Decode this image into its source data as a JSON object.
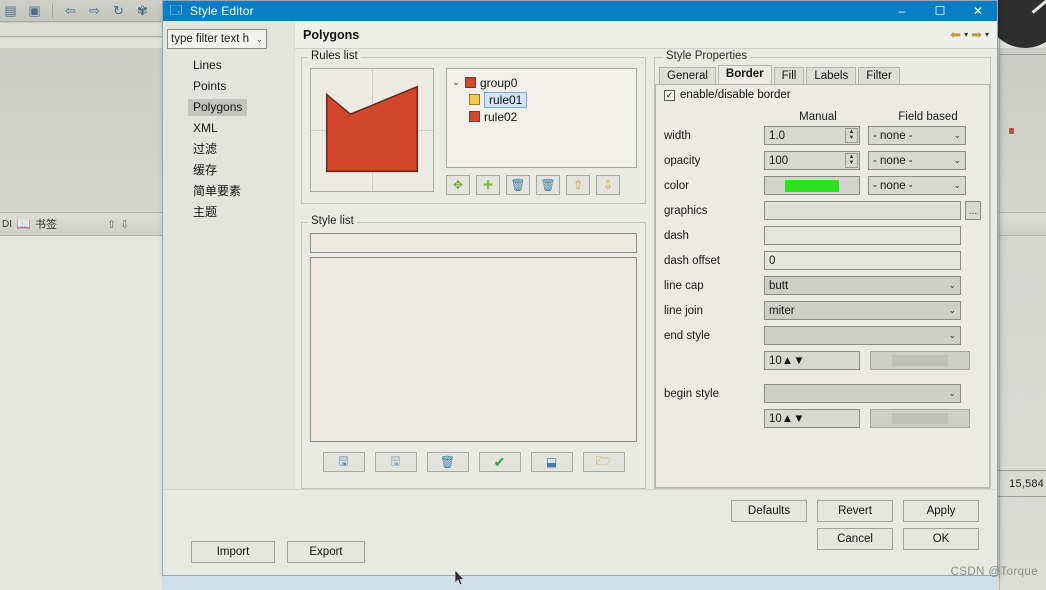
{
  "background": {
    "toolbar_icons": [
      "panel-icon",
      "panel-split-icon",
      "back-arrow-icon",
      "forward-arrow-icon",
      "refresh-icon",
      "globe-icon",
      "fullscreen-icon",
      "zoom-in-icon",
      "zoom-out-icon"
    ],
    "bookmark_label": "书签",
    "bookmark_prefix": "DI",
    "bookmark_up_icon": "up-arrow-icon",
    "bookmark_down_icon": "down-arrow-icon",
    "right_value": "15,584"
  },
  "window": {
    "title": "Style Editor",
    "app_icon": "style-editor-icon",
    "minimize": "–",
    "maximize": "☐",
    "close": "✕"
  },
  "sidebar": {
    "filter": {
      "value": "type filter text h",
      "placeholder": "type filter text here",
      "caret_icon": "chevron-down-icon"
    },
    "items": [
      {
        "label": "Lines",
        "selected": false
      },
      {
        "label": "Points",
        "selected": false
      },
      {
        "label": "Polygons",
        "selected": true
      },
      {
        "label": "XML",
        "selected": false
      },
      {
        "label": "过滤",
        "selected": false
      },
      {
        "label": "缓存",
        "selected": false
      },
      {
        "label": "简单要素",
        "selected": false
      },
      {
        "label": "主题",
        "selected": false
      }
    ]
  },
  "content": {
    "title": "Polygons",
    "header_actions": [
      {
        "name": "back-arrow-icon",
        "glyph": "⬅"
      },
      {
        "name": "chevron-down-icon",
        "glyph": "▾"
      },
      {
        "name": "forward-arrow-icon",
        "glyph": "➡"
      },
      {
        "name": "chevron-down-icon",
        "glyph": "▾"
      }
    ]
  },
  "rules": {
    "group_label": "Rules list",
    "preview_name": "polygon-preview",
    "preview_fill": "#d2472a",
    "preview_stroke": "#6b2a1c",
    "tree": [
      {
        "label": "group0",
        "level": 0,
        "swatch": "red",
        "selected": false,
        "twisty": "⌄"
      },
      {
        "label": "rule01",
        "level": 1,
        "swatch": "yellow",
        "selected": true,
        "twisty": ""
      },
      {
        "label": "rule02",
        "level": 1,
        "swatch": "red",
        "selected": false,
        "twisty": ""
      }
    ],
    "toolbar": [
      {
        "name": "add-group-button",
        "glyph": "✥"
      },
      {
        "name": "add-rule-button",
        "glyph": "✚"
      },
      {
        "name": "delete-rule-button",
        "glyph": "🗑"
      },
      {
        "name": "delete-all-rules-button",
        "glyph": "🗑"
      },
      {
        "name": "move-up-button",
        "glyph": "⇧"
      },
      {
        "name": "move-down-button",
        "glyph": "⇩"
      }
    ]
  },
  "style_list": {
    "group_label": "Style list",
    "field_value": "",
    "toolbar": [
      {
        "name": "save-style-button",
        "glyph": "💾"
      },
      {
        "name": "save-as-style-button",
        "glyph": "🖫"
      },
      {
        "name": "delete-style-button",
        "glyph": "🗑"
      },
      {
        "name": "validate-style-button",
        "glyph": "✔"
      },
      {
        "name": "export-style-button",
        "glyph": "⬓"
      },
      {
        "name": "open-style-button",
        "glyph": "📂"
      }
    ]
  },
  "style_properties": {
    "group_label": "Style Properties",
    "tabs": [
      {
        "label": "General",
        "active": false
      },
      {
        "label": "Border",
        "active": true
      },
      {
        "label": "Fill",
        "active": false
      },
      {
        "label": "Labels",
        "active": false
      },
      {
        "label": "Filter",
        "active": false
      }
    ],
    "enable_border": {
      "label": "enable/disable border",
      "checked": true,
      "check_glyph": "✓"
    },
    "columns": {
      "manual": "Manual",
      "field_based": "Field based"
    },
    "field_none": "- none -",
    "color_swatch": "#2ce022",
    "rows": [
      {
        "label": "width",
        "type": "spinner",
        "value": "1.0",
        "field": "- none -"
      },
      {
        "label": "opacity",
        "type": "spinner",
        "value": "100",
        "field": "- none -"
      },
      {
        "label": "color",
        "type": "color",
        "value": "",
        "field": "- none -"
      },
      {
        "label": "graphics",
        "type": "text-dots",
        "value": "",
        "field": ""
      },
      {
        "label": "dash",
        "type": "text",
        "value": "",
        "field": ""
      },
      {
        "label": "dash offset",
        "type": "text",
        "value": "0",
        "field": ""
      },
      {
        "label": "line cap",
        "type": "combo",
        "value": "butt",
        "field": ""
      },
      {
        "label": "line join",
        "type": "combo",
        "value": "miter",
        "field": ""
      },
      {
        "label": "end style",
        "type": "combo",
        "value": "",
        "field": ""
      },
      {
        "label": "",
        "type": "spinner-block",
        "value": "10",
        "field": ""
      },
      {
        "label": "begin style",
        "type": "combo",
        "value": "",
        "field": ""
      },
      {
        "label": "",
        "type": "spinner-block",
        "value": "10",
        "field": ""
      }
    ]
  },
  "footer": {
    "defaults": "Defaults",
    "revert": "Revert",
    "apply": "Apply",
    "cancel": "Cancel",
    "ok": "OK",
    "import": "Import",
    "export": "Export"
  },
  "watermark": "CSDN @Torque"
}
